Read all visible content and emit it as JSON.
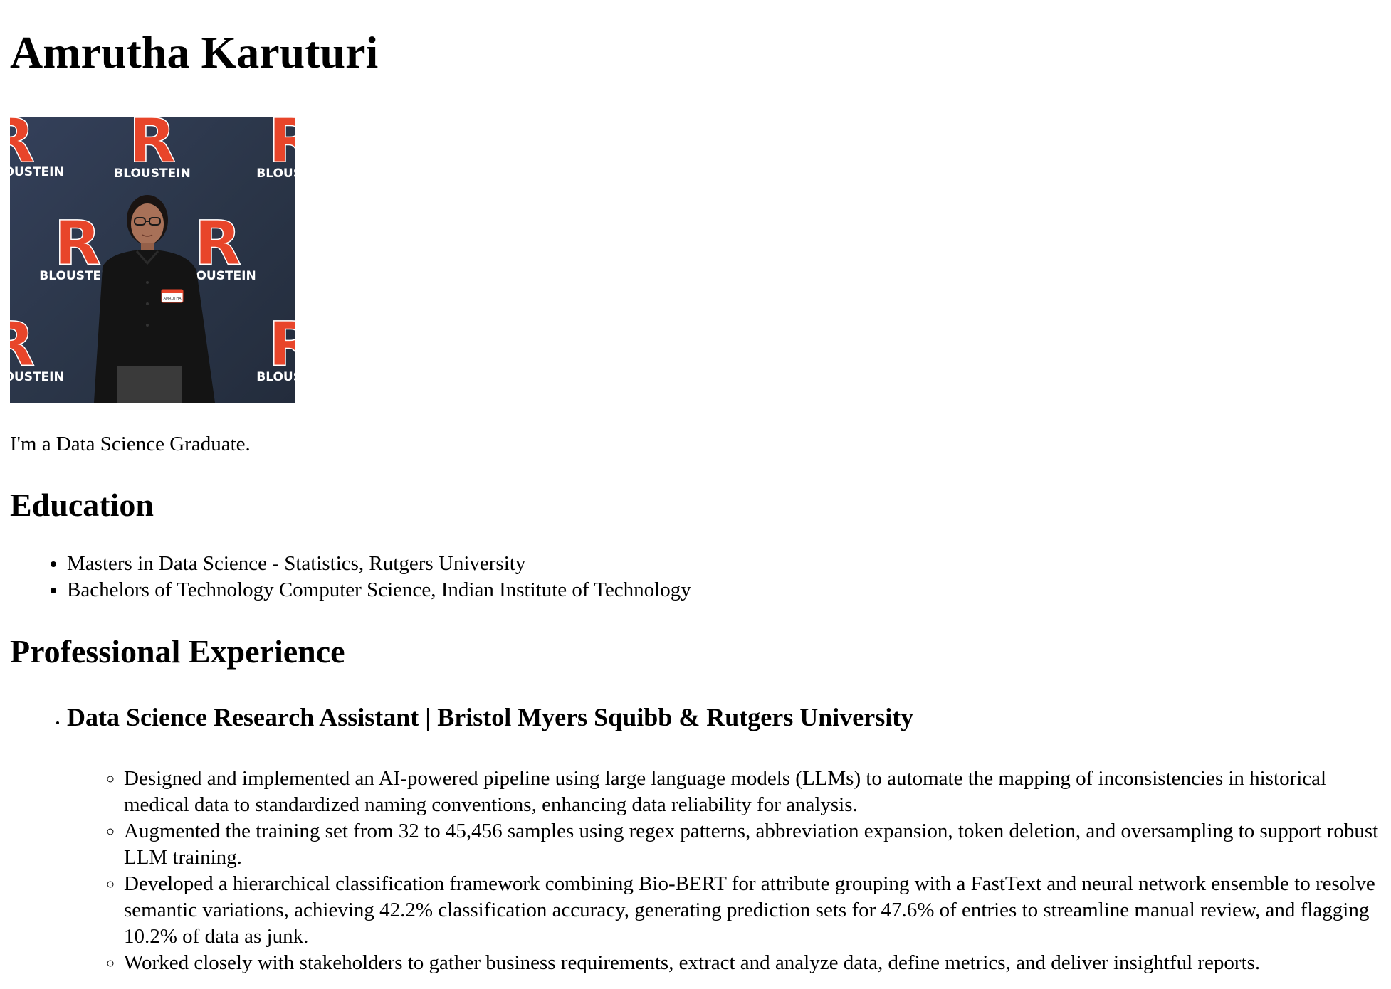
{
  "name": "Amrutha Karuturi",
  "photo": {
    "alt": "Amrutha Karuturi",
    "backdrop_text": "BLOUSTEIN",
    "backdrop_letter": "R",
    "badge_text": "AMRUTHA",
    "colors": {
      "backdrop": "#2b3649",
      "logo": "#e8452a",
      "text": "#ffffff",
      "clothing": "#141414"
    }
  },
  "intro": "I'm a Data Science Graduate.",
  "education": {
    "heading": "Education",
    "items": [
      "Masters in Data Science - Statistics, Rutgers University",
      "Bachelors of Technology Computer Science, Indian Institute of Technology"
    ]
  },
  "experience": {
    "heading": "Professional Experience",
    "jobs": [
      {
        "title": "Data Science Research Assistant | Bristol Myers Squibb & Rutgers University",
        "bullets": [
          "Designed and implemented an AI-powered pipeline using large language models (LLMs) to automate the mapping of inconsistencies in historical medical data to standardized naming conventions, enhancing data reliability for analysis.",
          "Augmented the training set from 32 to 45,456 samples using regex patterns, abbreviation expansion, token deletion, and oversampling to support robust LLM training.",
          "Developed a hierarchical classification framework combining Bio-BERT for attribute grouping with a FastText and neural network ensemble to resolve semantic variations, achieving 42.2% classification accuracy, generating prediction sets for 47.6% of entries to streamline manual review, and flagging 10.2% of data as junk.",
          "Worked closely with stakeholders to gather business requirements, extract and analyze data, define metrics, and deliver insightful reports."
        ]
      }
    ]
  }
}
